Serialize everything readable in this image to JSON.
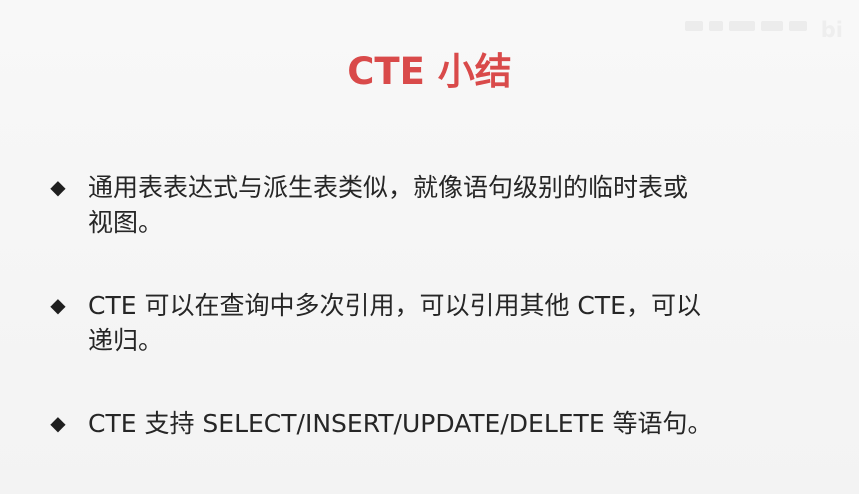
{
  "slide": {
    "title": "CTE 小结",
    "accent_color": "#d94a4a",
    "watermark_icon": "bili-logo-icon",
    "bullets": [
      {
        "marker": "◆",
        "text": "通用表表达式与派生表类似，就像语句级别的临时表或\n视图。"
      },
      {
        "marker": "◆",
        "text": "CTE 可以在查询中多次引用，可以引用其他 CTE，可以\n递归。"
      },
      {
        "marker": "◆",
        "text": "CTE 支持 SELECT/INSERT/UPDATE/DELETE 等语句。"
      }
    ]
  }
}
